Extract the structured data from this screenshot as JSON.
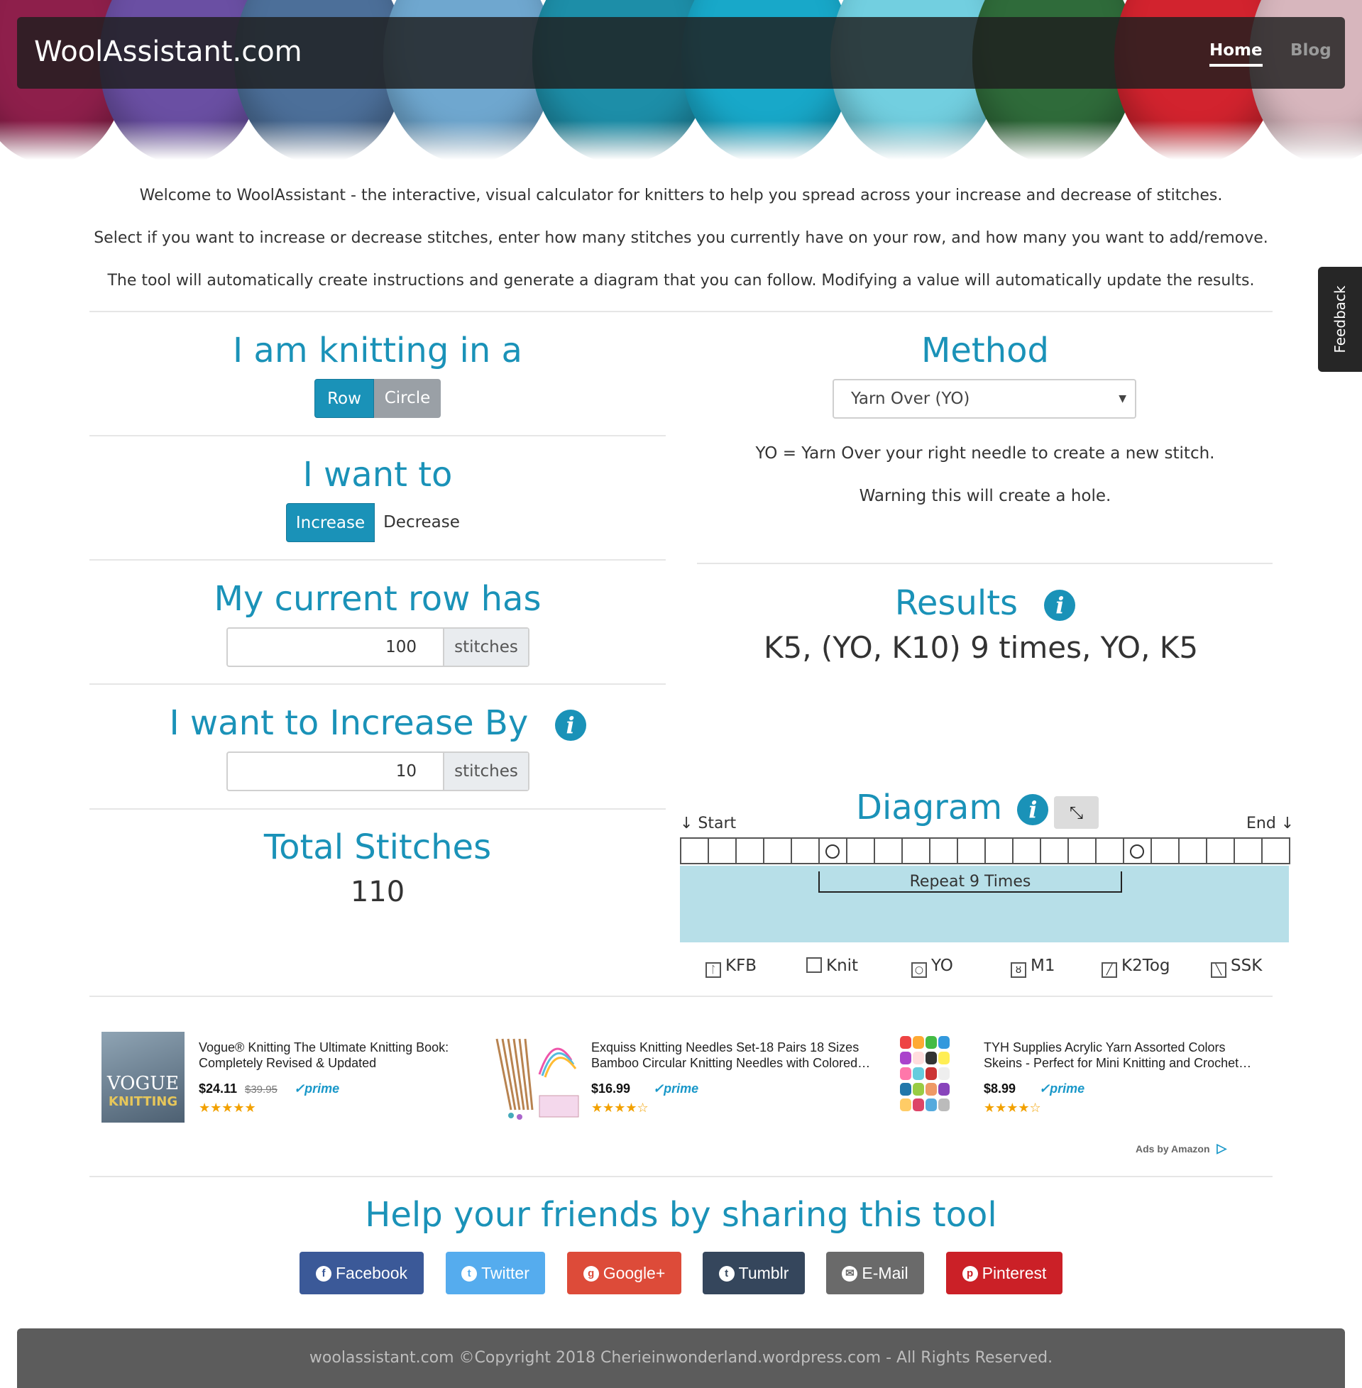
{
  "nav": {
    "brand": "WoolAssistant.com",
    "home": "Home",
    "blog": "Blog"
  },
  "intro": [
    "Welcome to WoolAssistant - the interactive, visual calculator for knitters to help you spread across your increase and decrease of stitches.",
    "Select if you want to increase or decrease stitches, enter how many stitches you currently have on your row, and how many you want to add/remove.",
    "The tool will automatically create instructions and generate a diagram that you can follow. Modifying a value will automatically update the results."
  ],
  "knitting": {
    "heading": "I am knitting in a",
    "row": "Row",
    "circle": "Circle",
    "selected": "Row"
  },
  "want": {
    "heading": "I want to",
    "increase": "Increase",
    "decrease": "Decrease",
    "selected": "Increase"
  },
  "current": {
    "heading": "My current row has",
    "value": "100",
    "unit": "stitches"
  },
  "increase_by": {
    "heading": "I want to Increase By",
    "value": "10",
    "unit": "stitches"
  },
  "total": {
    "heading": "Total Stitches",
    "value": "110"
  },
  "method": {
    "heading": "Method",
    "selected": "Yarn Over (YO)",
    "description": "YO = Yarn Over your right needle to create a new stitch.",
    "warning": "Warning this will create a hole."
  },
  "results": {
    "heading": "Results",
    "text": "K5, (YO, K10) 9 times, YO, K5"
  },
  "diagram": {
    "heading": "Diagram",
    "start": "↓ Start",
    "end": "End ↓",
    "repeat": "Repeat 9 Times",
    "cells_total": 22,
    "yo_cells": [
      5,
      16
    ]
  },
  "legend": [
    {
      "icon": "kfb-icon",
      "label": "KFB"
    },
    {
      "icon": "knit-icon",
      "label": "Knit"
    },
    {
      "icon": "yo-icon",
      "label": "YO"
    },
    {
      "icon": "m1-icon",
      "label": "M1"
    },
    {
      "icon": "k2tog-icon",
      "label": "K2Tog"
    },
    {
      "icon": "ssk-icon",
      "label": "SSK"
    }
  ],
  "products": [
    {
      "title1": "Vogue® Knitting The Ultimate Knitting Book:",
      "title2": "Completely Revised & Updated",
      "price": "$24.11",
      "old_price": "$39.95",
      "prime": "✓prime",
      "stars": "★★★★★"
    },
    {
      "title1": "Exquiss Knitting Needles Set-18 Pairs 18 Sizes",
      "title2": "Bamboo Circular Knitting Needles with Colored…",
      "price": "$16.99",
      "old_price": "",
      "prime": "✓prime",
      "stars": "★★★★☆"
    },
    {
      "title1": "TYH Supplies Acrylic Yarn Assorted Colors",
      "title2": "Skeins - Perfect for Mini Knitting and Crochet…",
      "price": "$8.99",
      "old_price": "",
      "prime": "✓prime",
      "stars": "★★★★☆"
    }
  ],
  "product_cover_text": {
    "line1": "VOGUE",
    "line2": "KNITTING"
  },
  "ads_by": "Ads by Amazon",
  "share": {
    "heading": "Help your friends by sharing this tool",
    "buttons": [
      "Facebook",
      "Twitter",
      "Google+",
      "Tumblr",
      "E-Mail",
      "Pinterest"
    ]
  },
  "colors": {
    "accent": "#1a92b8",
    "facebook": "#3b5998",
    "twitter": "#55acee",
    "google": "#dd4b39",
    "tumblr": "#35465c",
    "email": "#6a6a6a",
    "pinterest": "#cb2027"
  },
  "footer": "woolassistant.com ©Copyright 2018 Cherieinwonderland.wordpress.com - All Rights Reserved.",
  "feedback": "Feedback"
}
